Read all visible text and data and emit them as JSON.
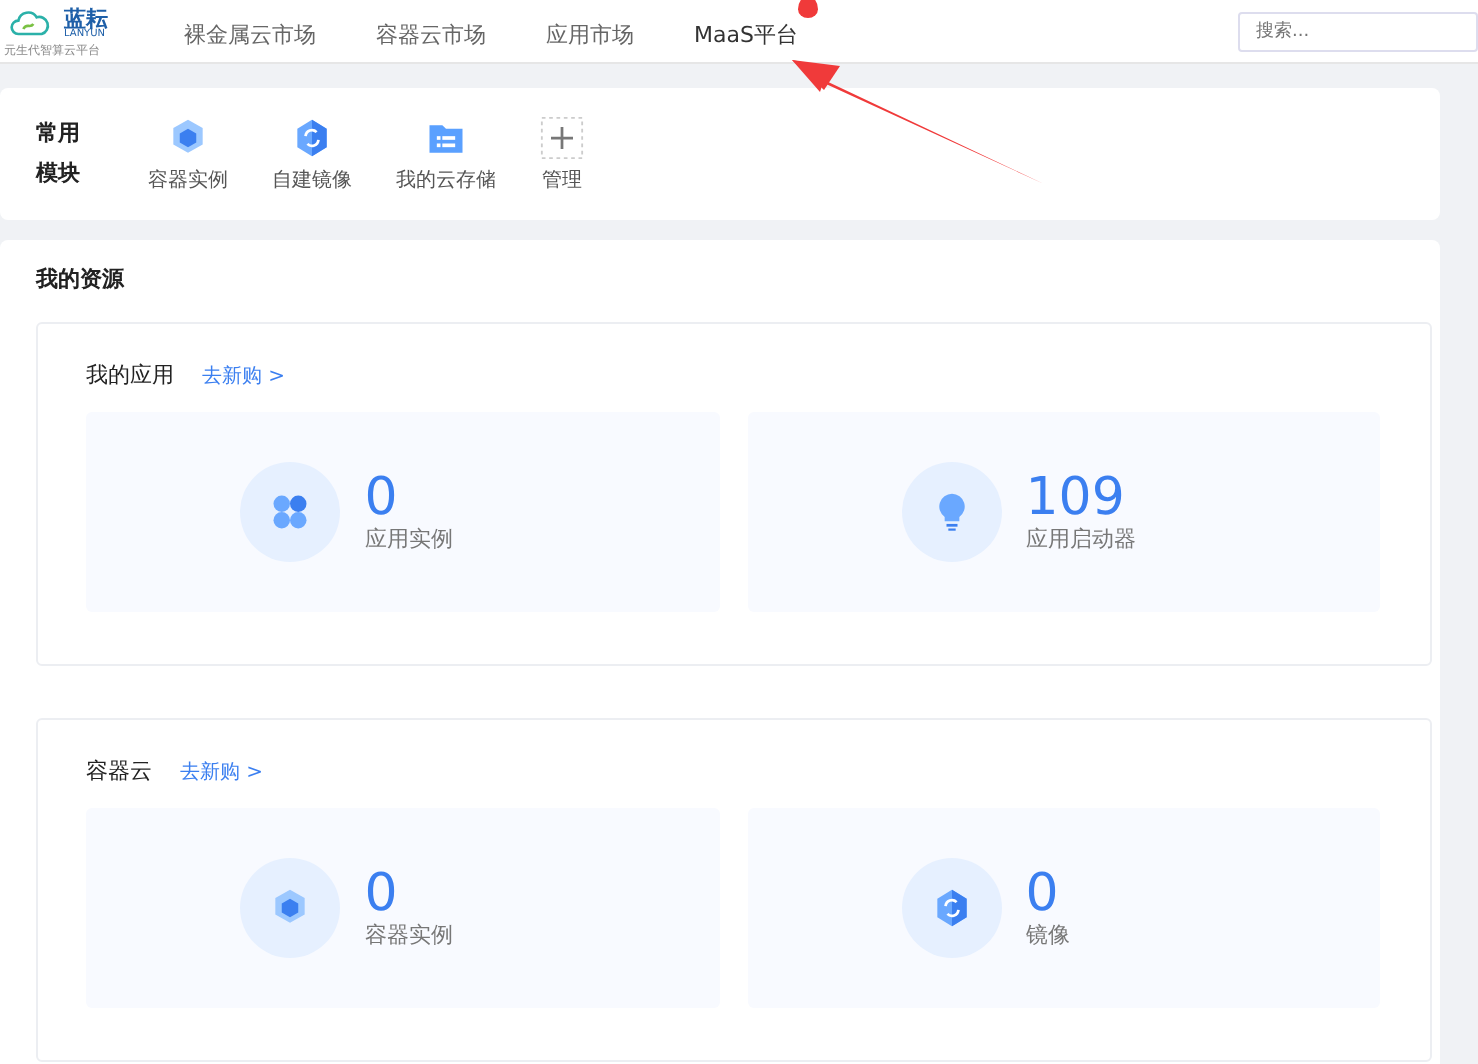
{
  "header": {
    "logo": {
      "name": "蓝耘",
      "latin": "LANYUN",
      "tagline": "元生代智算云平台"
    },
    "nav": [
      {
        "label": "裸金属云市场",
        "hot": false
      },
      {
        "label": "容器云市场",
        "hot": false
      },
      {
        "label": "应用市场",
        "hot": false
      },
      {
        "label": "MaaS平台",
        "hot": true
      }
    ],
    "search": {
      "placeholder": "搜索..."
    }
  },
  "quick_modules": {
    "title": "常用模块",
    "items": [
      {
        "kind": "container",
        "label": "容器实例"
      },
      {
        "kind": "image",
        "label": "自建镜像"
      },
      {
        "kind": "storage",
        "label": "我的云存储"
      },
      {
        "kind": "add",
        "label": "管理"
      }
    ]
  },
  "resources": {
    "title": "我的资源",
    "groups": [
      {
        "title": "我的应用",
        "link": "去新购 >",
        "stats": [
          {
            "kind": "app",
            "value": "0",
            "label": "应用实例"
          },
          {
            "kind": "bulb",
            "value": "109",
            "label": "应用启动器"
          }
        ]
      },
      {
        "title": "容器云",
        "link": "去新购 >",
        "stats": [
          {
            "kind": "container",
            "value": "0",
            "label": "容器实例"
          },
          {
            "kind": "image",
            "value": "0",
            "label": "镜像"
          }
        ]
      }
    ]
  }
}
